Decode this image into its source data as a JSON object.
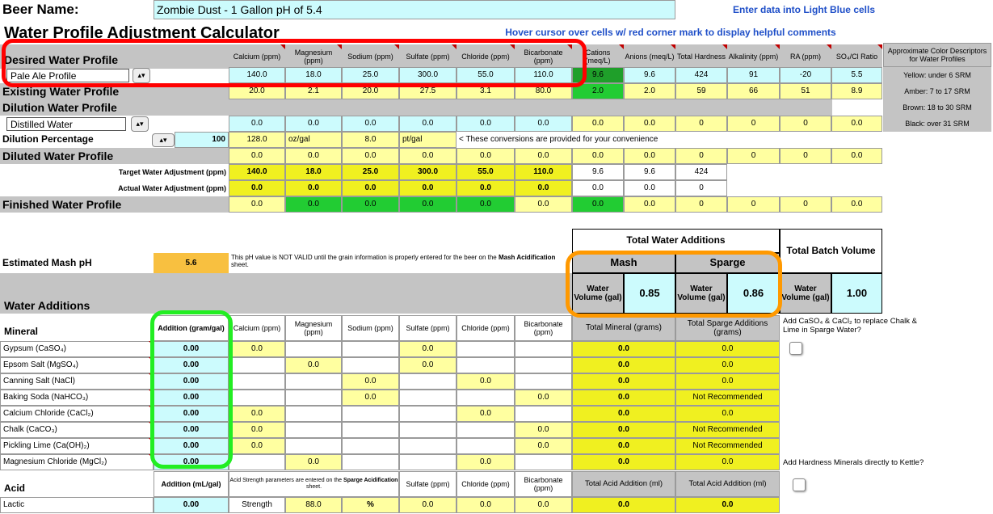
{
  "header": {
    "beer_name_label": "Beer Name:",
    "beer_name_value": "Zombie Dust - 1 Gallon pH of 5.4",
    "title": "Water Profile Adjustment Calculator",
    "hint_blue": "Enter data into Light Blue cells",
    "hint_hover": "Hover cursor over cells w/ red corner mark to display helpful comments"
  },
  "columns": {
    "calcium": "Calcium (ppm)",
    "magnesium": "Magnesium (ppm)",
    "sodium": "Sodium (ppm)",
    "sulfate": "Sulfate (ppm)",
    "chloride": "Chloride (ppm)",
    "bicarbonate": "Bicarbonate (ppm)",
    "cations": "Cations (meq/L)",
    "anions": "Anions (meq/L)",
    "hardness": "Total Hardness",
    "alkalinity": "Alkalinity (ppm)",
    "ra": "RA (ppm)",
    "so4cl": "SO₄/Cl Ratio"
  },
  "srm": {
    "title": "Approximate Color Descriptors for Water Profiles",
    "yellow": "Yellow: under 6 SRM",
    "amber": "Amber: 7 to 17 SRM",
    "brown": "Brown: 18 to 30 SRM",
    "black": "Black: over 31 SRM"
  },
  "profiles": {
    "desired_label": "Desired Water Profile",
    "desired_select": "Pale Ale Profile",
    "desired_values": [
      "140.0",
      "18.0",
      "25.0",
      "300.0",
      "55.0",
      "110.0",
      "9.6",
      "9.6",
      "424",
      "91",
      "-20",
      "5.5"
    ],
    "existing_label": "Existing Water Profile",
    "existing_values": [
      "20.0",
      "2.1",
      "20.0",
      "27.5",
      "3.1",
      "80.0",
      "2.0",
      "2.0",
      "59",
      "66",
      "51",
      "8.9"
    ],
    "dilution_label": "Dilution Water Profile",
    "dilution_select": "Distilled Water",
    "dilution_values": [
      "0.0",
      "0.0",
      "0.0",
      "0.0",
      "0.0",
      "0.0",
      "0.0",
      "0.0",
      "0",
      "0",
      "0",
      "0.0"
    ],
    "dilution_pct_label": "Dilution Percentage",
    "dilution_pct_value": "100",
    "conv_1": "128.0",
    "conv_1_unit": "oz/gal",
    "conv_2": "8.0",
    "conv_2_unit": "pt/gal",
    "conv_note": "< These conversions are provided for your convenience",
    "diluted_label": "Diluted Water Profile",
    "diluted_values": [
      "0.0",
      "0.0",
      "0.0",
      "0.0",
      "0.0",
      "0.0",
      "0.0",
      "0.0",
      "0",
      "0",
      "0",
      "0.0"
    ],
    "target_label": "Target Water Adjustment (ppm)",
    "target_values": [
      "140.0",
      "18.0",
      "25.0",
      "300.0",
      "55.0",
      "110.0",
      "9.6",
      "9.6",
      "424"
    ],
    "actual_label": "Actual Water Adjustment (ppm)",
    "actual_values": [
      "0.0",
      "0.0",
      "0.0",
      "0.0",
      "0.0",
      "0.0",
      "0.0",
      "0.0",
      "0"
    ],
    "finished_label": "Finished Water Profile",
    "finished_values": [
      "0.0",
      "0.0",
      "0.0",
      "0.0",
      "0.0",
      "0.0",
      "0.0",
      "0.0",
      "0",
      "0",
      "0",
      "0.0"
    ]
  },
  "totals": {
    "total_additions": "Total Water Additions",
    "mash": "Mash",
    "sparge": "Sparge",
    "batch_volume": "Total Batch Volume",
    "water_volume": "Water Volume (gal)",
    "mash_volume": "0.85",
    "sparge_volume": "0.86",
    "batch_value": "1.00"
  },
  "ph": {
    "label": "Estimated Mash pH",
    "value": "5.6",
    "note_pre": "This pH value is NOT VALID until the grain information is properly entered for the beer on the ",
    "note_bold": "Mash Acidification",
    "note_post": " sheet."
  },
  "additions": {
    "section_label": "Water Additions",
    "mineral_label": "Mineral",
    "addition_header": "Addition (gram/gal)",
    "total_header_mash": "Total Mineral (grams)",
    "total_header_sparge": "Total Sparge Additions (grams)",
    "add_caso4_note": "Add CaSO₄ & CaCl₂ to replace Chalk & Lime in Sparge Water?",
    "hardness_note": "Add Hardness Minerals directly to Kettle?",
    "rows": [
      {
        "name": "Gypsum (CaSO₄)",
        "add": "0.00",
        "cells": [
          "0.0",
          "",
          "",
          "0.0",
          "",
          ""
        ],
        "mash": "0.0",
        "sparge": "0.0"
      },
      {
        "name": "Epsom Salt (MgSO₄)",
        "add": "0.00",
        "cells": [
          "",
          "0.0",
          "",
          "0.0",
          "",
          ""
        ],
        "mash": "0.0",
        "sparge": "0.0"
      },
      {
        "name": "Canning Salt (NaCl)",
        "add": "0.00",
        "cells": [
          "",
          "",
          "0.0",
          "",
          "0.0",
          ""
        ],
        "mash": "0.0",
        "sparge": "0.0"
      },
      {
        "name": "Baking Soda (NaHCO₃)",
        "add": "0.00",
        "cells": [
          "",
          "",
          "0.0",
          "",
          "",
          "0.0"
        ],
        "mash": "0.0",
        "sparge": "Not Recommended"
      },
      {
        "name": "Calcium Chloride (CaCl₂)",
        "add": "0.00",
        "cells": [
          "0.0",
          "",
          "",
          "",
          "0.0",
          ""
        ],
        "mash": "0.0",
        "sparge": "0.0"
      },
      {
        "name": "Chalk (CaCO₃)",
        "add": "0.00",
        "cells": [
          "0.0",
          "",
          "",
          "",
          "",
          "0.0"
        ],
        "mash": "0.0",
        "sparge": "Not Recommended"
      },
      {
        "name": "Pickling Lime (Ca(OH)₂)",
        "add": "0.00",
        "cells": [
          "0.0",
          "",
          "",
          "",
          "",
          "0.0"
        ],
        "mash": "0.0",
        "sparge": "Not Recommended"
      },
      {
        "name": "Magnesium Chloride (MgCl₂)",
        "add": "0.00",
        "cells": [
          "",
          "0.0",
          "",
          "",
          "0.0",
          ""
        ],
        "mash": "0.0",
        "sparge": "0.0"
      }
    ]
  },
  "acid": {
    "section_label": "Acid",
    "addition_header": "Addition (mL/gal)",
    "strength_note_pre": "Acid Strength parameters are entered on the ",
    "strength_note_bold": "Sparge Acidification",
    "strength_note_post": " sheet.",
    "sulfate": "Sulfate (ppm)",
    "chloride": "Chloride (ppm)",
    "bicarbonate": "Bicarbonate (ppm)",
    "total_mash": "Total Acid Addition (ml)",
    "total_sparge": "Total Acid Addition (ml)",
    "row_name": "Lactic",
    "row_add": "0.00",
    "strength_label": "Strength",
    "strength_value": "88.0",
    "strength_unit": "%",
    "row_sulfate": "0.0",
    "row_chloride": "0.0",
    "row_bicarb": "0.0",
    "row_mash": "0.0",
    "row_sparge": "0.0"
  },
  "colors": {
    "light_blue": "#ccfbfd",
    "light_yellow": "#ffffa0",
    "yellow": "#f0f020",
    "green": "#22cc33",
    "red_highlight": "#ff0000",
    "orange_highlight": "#ff9900",
    "green_highlight": "#22ee22"
  }
}
